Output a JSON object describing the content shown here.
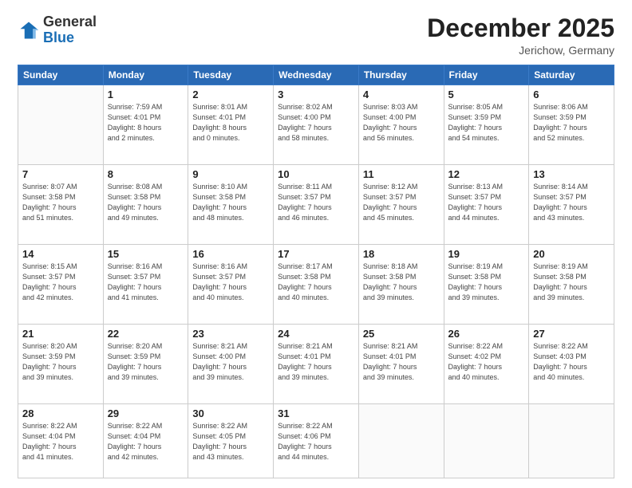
{
  "header": {
    "logo": {
      "general": "General",
      "blue": "Blue"
    },
    "title": "December 2025",
    "location": "Jerichow, Germany"
  },
  "weekdays": [
    "Sunday",
    "Monday",
    "Tuesday",
    "Wednesday",
    "Thursday",
    "Friday",
    "Saturday"
  ],
  "weeks": [
    [
      {
        "day": "",
        "info": ""
      },
      {
        "day": "1",
        "info": "Sunrise: 7:59 AM\nSunset: 4:01 PM\nDaylight: 8 hours\nand 2 minutes."
      },
      {
        "day": "2",
        "info": "Sunrise: 8:01 AM\nSunset: 4:01 PM\nDaylight: 8 hours\nand 0 minutes."
      },
      {
        "day": "3",
        "info": "Sunrise: 8:02 AM\nSunset: 4:00 PM\nDaylight: 7 hours\nand 58 minutes."
      },
      {
        "day": "4",
        "info": "Sunrise: 8:03 AM\nSunset: 4:00 PM\nDaylight: 7 hours\nand 56 minutes."
      },
      {
        "day": "5",
        "info": "Sunrise: 8:05 AM\nSunset: 3:59 PM\nDaylight: 7 hours\nand 54 minutes."
      },
      {
        "day": "6",
        "info": "Sunrise: 8:06 AM\nSunset: 3:59 PM\nDaylight: 7 hours\nand 52 minutes."
      }
    ],
    [
      {
        "day": "7",
        "info": "Sunrise: 8:07 AM\nSunset: 3:58 PM\nDaylight: 7 hours\nand 51 minutes."
      },
      {
        "day": "8",
        "info": "Sunrise: 8:08 AM\nSunset: 3:58 PM\nDaylight: 7 hours\nand 49 minutes."
      },
      {
        "day": "9",
        "info": "Sunrise: 8:10 AM\nSunset: 3:58 PM\nDaylight: 7 hours\nand 48 minutes."
      },
      {
        "day": "10",
        "info": "Sunrise: 8:11 AM\nSunset: 3:57 PM\nDaylight: 7 hours\nand 46 minutes."
      },
      {
        "day": "11",
        "info": "Sunrise: 8:12 AM\nSunset: 3:57 PM\nDaylight: 7 hours\nand 45 minutes."
      },
      {
        "day": "12",
        "info": "Sunrise: 8:13 AM\nSunset: 3:57 PM\nDaylight: 7 hours\nand 44 minutes."
      },
      {
        "day": "13",
        "info": "Sunrise: 8:14 AM\nSunset: 3:57 PM\nDaylight: 7 hours\nand 43 minutes."
      }
    ],
    [
      {
        "day": "14",
        "info": "Sunrise: 8:15 AM\nSunset: 3:57 PM\nDaylight: 7 hours\nand 42 minutes."
      },
      {
        "day": "15",
        "info": "Sunrise: 8:16 AM\nSunset: 3:57 PM\nDaylight: 7 hours\nand 41 minutes."
      },
      {
        "day": "16",
        "info": "Sunrise: 8:16 AM\nSunset: 3:57 PM\nDaylight: 7 hours\nand 40 minutes."
      },
      {
        "day": "17",
        "info": "Sunrise: 8:17 AM\nSunset: 3:58 PM\nDaylight: 7 hours\nand 40 minutes."
      },
      {
        "day": "18",
        "info": "Sunrise: 8:18 AM\nSunset: 3:58 PM\nDaylight: 7 hours\nand 39 minutes."
      },
      {
        "day": "19",
        "info": "Sunrise: 8:19 AM\nSunset: 3:58 PM\nDaylight: 7 hours\nand 39 minutes."
      },
      {
        "day": "20",
        "info": "Sunrise: 8:19 AM\nSunset: 3:58 PM\nDaylight: 7 hours\nand 39 minutes."
      }
    ],
    [
      {
        "day": "21",
        "info": "Sunrise: 8:20 AM\nSunset: 3:59 PM\nDaylight: 7 hours\nand 39 minutes."
      },
      {
        "day": "22",
        "info": "Sunrise: 8:20 AM\nSunset: 3:59 PM\nDaylight: 7 hours\nand 39 minutes."
      },
      {
        "day": "23",
        "info": "Sunrise: 8:21 AM\nSunset: 4:00 PM\nDaylight: 7 hours\nand 39 minutes."
      },
      {
        "day": "24",
        "info": "Sunrise: 8:21 AM\nSunset: 4:01 PM\nDaylight: 7 hours\nand 39 minutes."
      },
      {
        "day": "25",
        "info": "Sunrise: 8:21 AM\nSunset: 4:01 PM\nDaylight: 7 hours\nand 39 minutes."
      },
      {
        "day": "26",
        "info": "Sunrise: 8:22 AM\nSunset: 4:02 PM\nDaylight: 7 hours\nand 40 minutes."
      },
      {
        "day": "27",
        "info": "Sunrise: 8:22 AM\nSunset: 4:03 PM\nDaylight: 7 hours\nand 40 minutes."
      }
    ],
    [
      {
        "day": "28",
        "info": "Sunrise: 8:22 AM\nSunset: 4:04 PM\nDaylight: 7 hours\nand 41 minutes."
      },
      {
        "day": "29",
        "info": "Sunrise: 8:22 AM\nSunset: 4:04 PM\nDaylight: 7 hours\nand 42 minutes."
      },
      {
        "day": "30",
        "info": "Sunrise: 8:22 AM\nSunset: 4:05 PM\nDaylight: 7 hours\nand 43 minutes."
      },
      {
        "day": "31",
        "info": "Sunrise: 8:22 AM\nSunset: 4:06 PM\nDaylight: 7 hours\nand 44 minutes."
      },
      {
        "day": "",
        "info": ""
      },
      {
        "day": "",
        "info": ""
      },
      {
        "day": "",
        "info": ""
      }
    ]
  ]
}
